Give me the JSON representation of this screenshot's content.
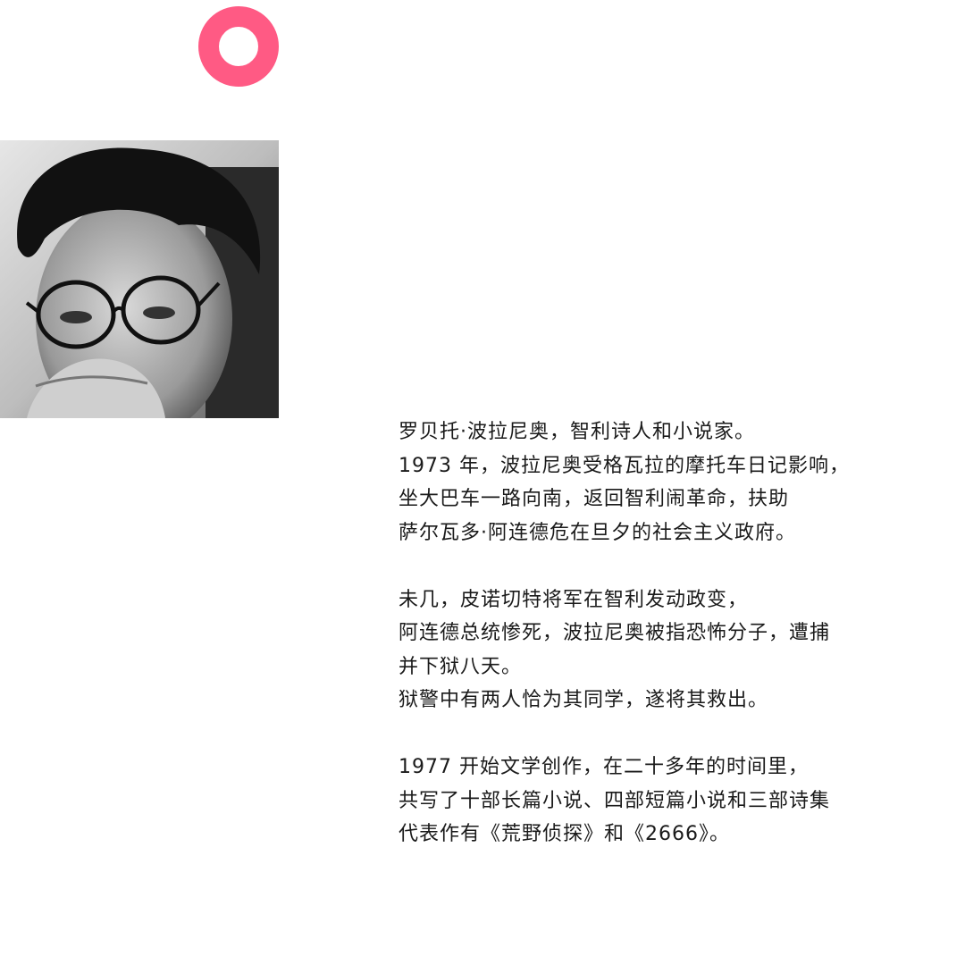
{
  "accent_color": "#ff5a84",
  "decoration": {
    "icon": "ring-icon"
  },
  "portrait": {
    "alt": "black-and-white portrait photo"
  },
  "bio": {
    "paragraphs": [
      [
        "罗贝托·波拉尼奥，智利诗人和小说家。",
        "1973 年，波拉尼奥受格瓦拉的摩托车日记影响，",
        "坐大巴车一路向南，返回智利闹革命，扶助",
        "萨尔瓦多·阿连德危在旦夕的社会主义政府。"
      ],
      [
        "未几，皮诺切特将军在智利发动政变，",
        "阿连德总统惨死，波拉尼奥被指恐怖分子，遭捕",
        "并下狱八天。",
        "狱警中有两人恰为其同学，遂将其救出。"
      ],
      [
        "1977 开始文学创作，在二十多年的时间里，",
        "共写了十部长篇小说、四部短篇小说和三部诗集",
        "代表作有《荒野侦探》和《2666》。"
      ]
    ]
  }
}
